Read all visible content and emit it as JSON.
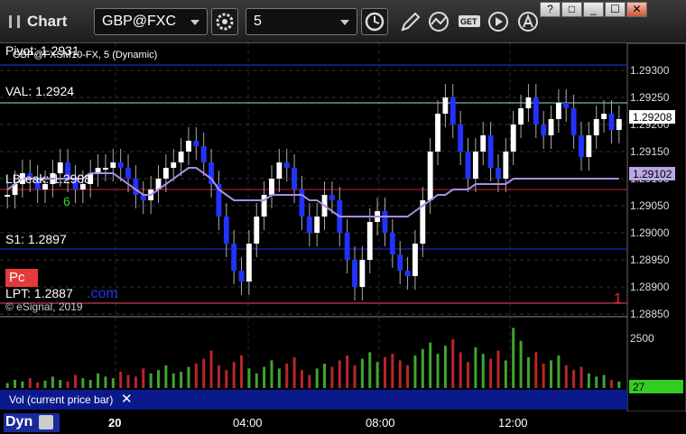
{
  "app": {
    "title": "Chart"
  },
  "toolbar": {
    "symbol": "GBP@FXC",
    "interval": "5",
    "window_buttons": [
      "?",
      "□",
      "_",
      "☐",
      "✕"
    ]
  },
  "chart": {
    "legend": "GBP@FXSM10-FX, 5 (Dynamic)",
    "copyright": "© eSignal, 2019",
    "pc_badge": "Pc",
    "wave_label": "6",
    "lpt_suffix": ".com",
    "marker": "1",
    "levels": [
      {
        "name": "Pivot",
        "text": "Pivot: 1.2931",
        "value": 1.2931,
        "color": "#2233ee"
      },
      {
        "name": "VAL",
        "text": "VAL: 1.2924",
        "value": 1.2924,
        "color": "#9fd8d8"
      },
      {
        "name": "LBreak",
        "text": "LBreak: 1.2908",
        "value": 1.2908,
        "color": "#cc2233"
      },
      {
        "name": "S1",
        "text": "S1: 1.2897",
        "value": 1.2897,
        "color": "#2233ee"
      },
      {
        "name": "LPT",
        "text": "LPT: 1.2887",
        "value": 1.2887,
        "color": "#ff4466"
      }
    ],
    "price_axis": [
      "1.29300",
      "1.29250",
      "1.29200",
      "1.29150",
      "1.29100",
      "1.29050",
      "1.29000",
      "1.28950",
      "1.28900",
      "1.28850"
    ],
    "last_price": "1.29208",
    "ma_price": "1.29102",
    "volume_axis": [
      "2500"
    ],
    "volume_last": "27",
    "volume_label": "Vol (current price bar)",
    "time_axis": [
      "20",
      "04:00",
      "08:00",
      "12:00"
    ],
    "dyn_label": "Dyn"
  },
  "chart_data": {
    "type": "candlestick",
    "symbol": "GBP@FXC",
    "interval": "5",
    "ylim": [
      1.2885,
      1.2935
    ],
    "series": [
      {
        "name": "price",
        "values": [
          1.2907,
          1.2909,
          1.2911,
          1.291,
          1.2908,
          1.2909,
          1.2911,
          1.2913,
          1.291,
          1.2908,
          1.2909,
          1.2911,
          1.2912,
          1.2912,
          1.2913,
          1.2912,
          1.291,
          1.2907,
          1.2906,
          1.2908,
          1.291,
          1.2912,
          1.2913,
          1.2915,
          1.2917,
          1.2916,
          1.2913,
          1.2909,
          1.2903,
          1.2898,
          1.2893,
          1.2891,
          1.2898,
          1.2903,
          1.2907,
          1.291,
          1.2913,
          1.2912,
          1.2908,
          1.2903,
          1.29,
          1.2903,
          1.2907,
          1.2906,
          1.29,
          1.2895,
          1.289,
          1.2895,
          1.2902,
          1.2904,
          1.29,
          1.2896,
          1.2893,
          1.2892,
          1.2898,
          1.2906,
          1.2915,
          1.2922,
          1.2925,
          1.292,
          1.2915,
          1.291,
          1.2915,
          1.2918,
          1.2912,
          1.291,
          1.2915,
          1.292,
          1.2923,
          1.2925,
          1.292,
          1.2918,
          1.2921,
          1.2924,
          1.2923,
          1.2918,
          1.2914,
          1.2918,
          1.2921,
          1.2922,
          1.2919,
          1.2921
        ]
      },
      {
        "name": "moving-average",
        "values": [
          1.2908,
          1.2909,
          1.291,
          1.291,
          1.291,
          1.291,
          1.291,
          1.291,
          1.291,
          1.291,
          1.291,
          1.2911,
          1.2911,
          1.2911,
          1.2911,
          1.291,
          1.2909,
          1.2908,
          1.2907,
          1.2907,
          1.2908,
          1.2909,
          1.291,
          1.2911,
          1.2912,
          1.2912,
          1.2911,
          1.291,
          1.2908,
          1.2907,
          1.2906,
          1.2906,
          1.2906,
          1.2906,
          1.2906,
          1.2907,
          1.2907,
          1.2907,
          1.2907,
          1.2907,
          1.2906,
          1.2906,
          1.2905,
          1.2904,
          1.2903,
          1.2903,
          1.2903,
          1.2903,
          1.2903,
          1.2903,
          1.2903,
          1.2903,
          1.2903,
          1.2903,
          1.2904,
          1.2905,
          1.2906,
          1.2907,
          1.2907,
          1.2908,
          1.2908,
          1.2908,
          1.2909,
          1.2909,
          1.2909,
          1.2909,
          1.2909,
          1.291,
          1.291,
          1.291,
          1.291,
          1.291,
          1.291,
          1.291,
          1.291,
          1.291,
          1.291,
          1.291,
          1.291,
          1.291,
          1.291,
          1.291
        ]
      },
      {
        "name": "volume",
        "values": [
          300,
          500,
          400,
          600,
          350,
          450,
          700,
          500,
          400,
          800,
          600,
          500,
          900,
          700,
          600,
          1000,
          800,
          700,
          1200,
          900,
          1100,
          1400,
          900,
          1000,
          1300,
          1500,
          1800,
          2300,
          1400,
          1100,
          1600,
          2000,
          1200,
          900,
          1300,
          1700,
          1200,
          1500,
          1900,
          1100,
          800,
          1200,
          1500,
          1300,
          1700,
          2000,
          1400,
          1800,
          2200,
          1600,
          1900,
          2100,
          1700,
          1400,
          2000,
          2400,
          2800,
          2100,
          2600,
          3000,
          2200,
          1600,
          2500,
          2100,
          1800,
          2300,
          1700,
          3700,
          2900,
          1900,
          2200,
          1500,
          1700,
          2000,
          1400,
          1100,
          1300,
          900,
          700,
          800,
          500,
          400
        ]
      }
    ]
  }
}
